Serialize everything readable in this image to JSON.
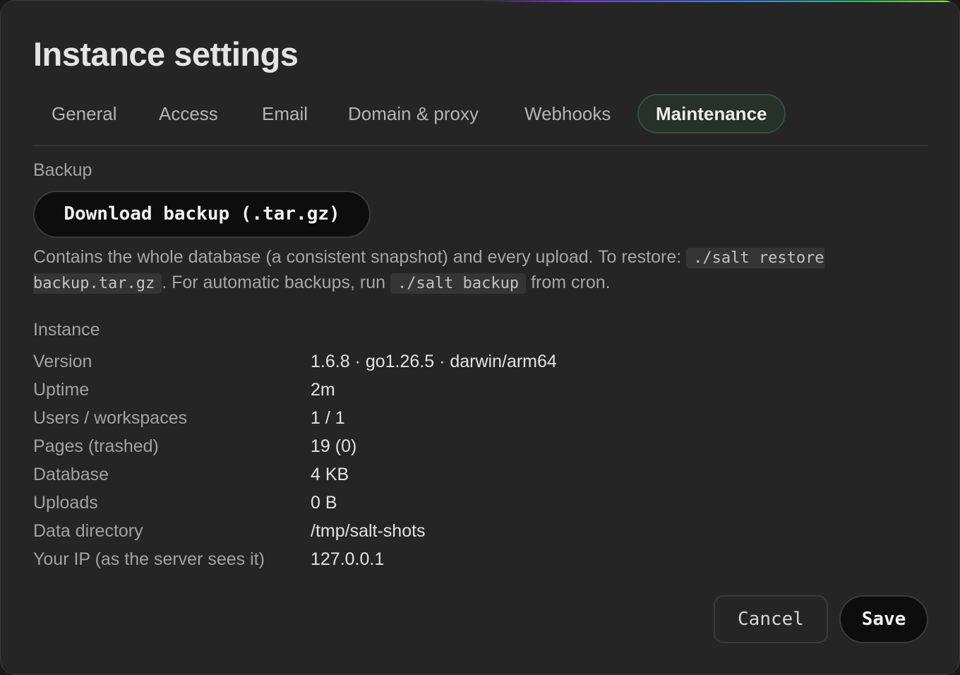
{
  "dialog": {
    "title": "Instance settings"
  },
  "tabs": [
    {
      "label": "General"
    },
    {
      "label": "Access"
    },
    {
      "label": "Email"
    },
    {
      "label": "Domain & proxy"
    },
    {
      "label": "Webhooks"
    },
    {
      "label": "Maintenance",
      "active": true
    }
  ],
  "backup": {
    "section_label": "Backup",
    "button_label": "Download backup (.tar.gz)",
    "description_part1": "Contains the whole database (a consistent snapshot) and every upload. To restore: ",
    "restore_command": "./salt restore backup.tar.gz",
    "description_part2": ". For automatic backups, run ",
    "backup_command": "./salt backup",
    "description_part3": " from cron."
  },
  "instance": {
    "section_label": "Instance",
    "rows": [
      {
        "label": "Version",
        "value": "1.6.8 · go1.26.5 · darwin/arm64"
      },
      {
        "label": "Uptime",
        "value": "2m"
      },
      {
        "label": "Users / workspaces",
        "value": "1 / 1"
      },
      {
        "label": "Pages (trashed)",
        "value": "19 (0)"
      },
      {
        "label": "Database",
        "value": "4 KB"
      },
      {
        "label": "Uploads",
        "value": "0 B"
      },
      {
        "label": "Data directory",
        "value": "/tmp/salt-shots"
      },
      {
        "label": "Your IP (as the server sees it)",
        "value": "127.0.0.1"
      }
    ]
  },
  "footer": {
    "cancel_label": "Cancel",
    "save_label": "Save"
  },
  "colors": {
    "background": "#252525",
    "active_tab_bg": "#263129",
    "active_tab_border": "#34503e",
    "button_dark": "#0d0d0d"
  }
}
